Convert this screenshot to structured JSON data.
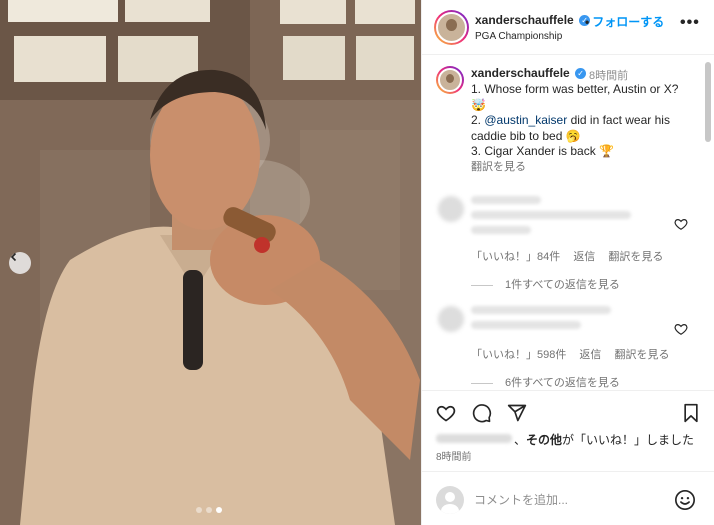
{
  "post": {
    "username": "xanderschauffele",
    "follow_separator": "•",
    "follow_label": "フォローする",
    "location": "PGA Championship",
    "more_label": "•••",
    "verified_glyph": "✓"
  },
  "caption": {
    "username": "xanderschauffele",
    "time": "8時間前",
    "line1": "1. Whose form was better, Austin or X?",
    "line1_emoji": "🤯",
    "line2_prefix": "2. ",
    "mention": "@austin_kaiser",
    "line2_suffix": " did in fact wear his caddie bib to bed",
    "line2_emoji": "🥱",
    "line3": "3. Cigar Xander is back",
    "line3_emoji": "🏆",
    "translate": "翻訳を見る"
  },
  "comments": [
    {
      "likes_label": "「いいね！」84件",
      "reply_label": "返信",
      "translate_label": "翻訳を見る",
      "view_replies": "1件すべての返信を見る"
    },
    {
      "likes_label": "「いいね！」598件",
      "reply_label": "返信",
      "translate_label": "翻訳を見る",
      "view_replies": "6件すべての返信を見る"
    }
  ],
  "likes": {
    "separator": "、",
    "others": "その他",
    "suffix": "が「いいね！」しました"
  },
  "post_time": "8時間前",
  "comment_box": {
    "placeholder": "コメントを追加..."
  },
  "carousel": {
    "total": 3,
    "active_index": 3
  },
  "colors": {
    "link": "#0095f6",
    "mention": "#00376b",
    "verified": "#3897f0"
  }
}
